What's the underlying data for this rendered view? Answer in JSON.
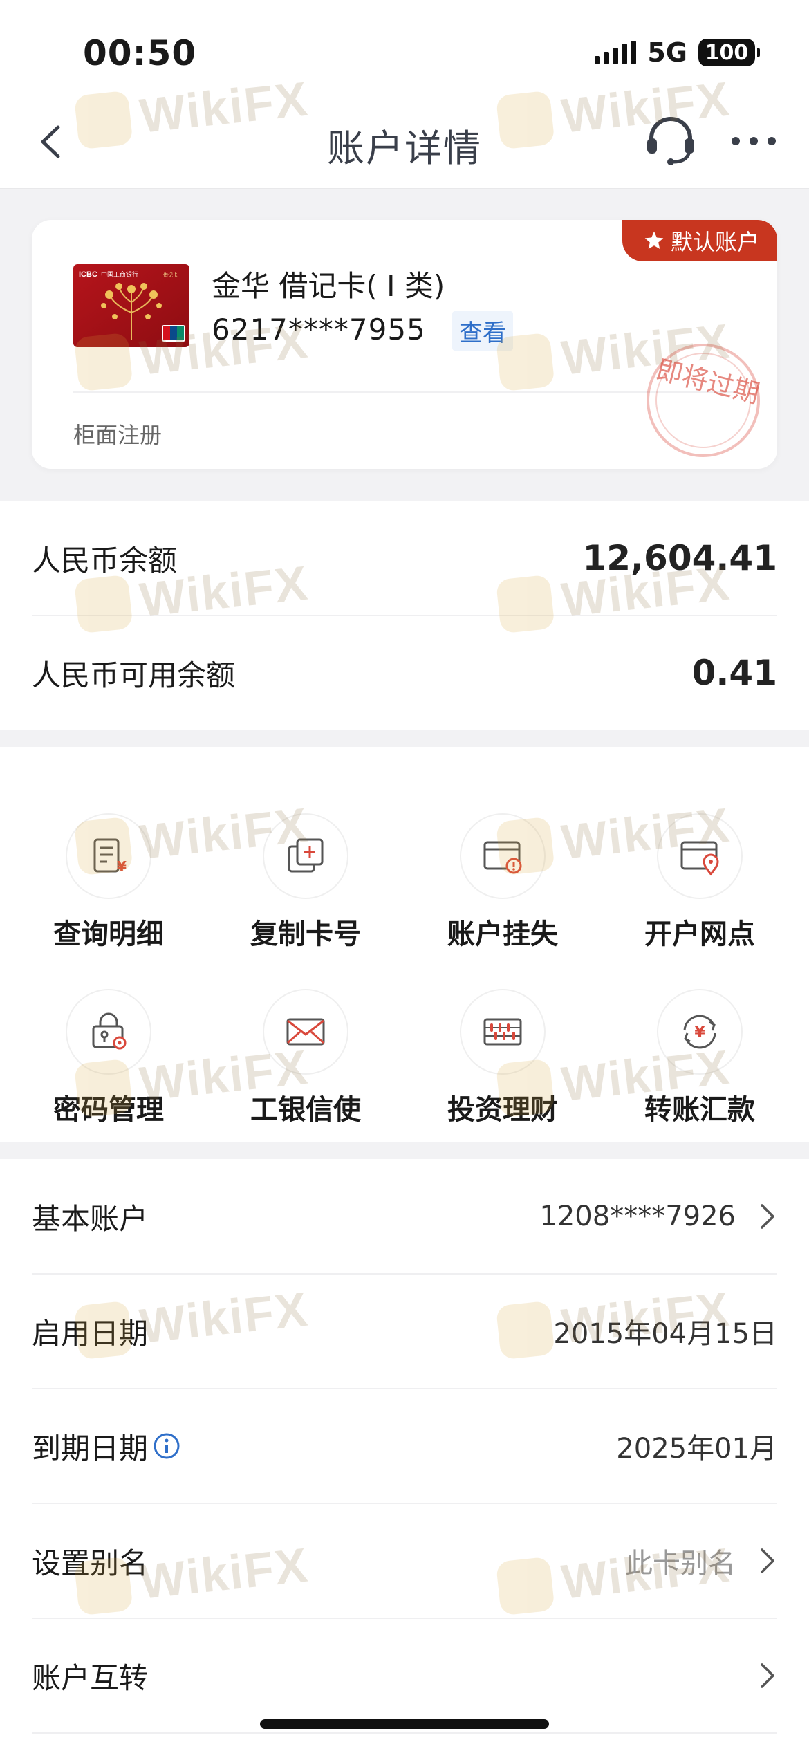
{
  "status_bar": {
    "time": "00:50",
    "network": "5G",
    "battery": "100"
  },
  "nav": {
    "title": "账户详情"
  },
  "card": {
    "default_badge": "默认账户",
    "name": "金华 借记卡( Ⅰ 类)",
    "number": "6217****7955",
    "view_label": "查看",
    "registration": "柜面注册",
    "stamp_text": "即将过期",
    "card_face": {
      "bank_short": "ICBC",
      "bank_name": "中国工商银行",
      "card_type": "借记卡",
      "network": "UnionPay"
    }
  },
  "balances": [
    {
      "label": "人民币余额",
      "value": "12,604.41"
    },
    {
      "label": "人民币可用余额",
      "value": "0.41"
    }
  ],
  "actions": [
    {
      "label": "查询明细",
      "icon": "statement-icon"
    },
    {
      "label": "复制卡号",
      "icon": "copy-card-icon"
    },
    {
      "label": "账户挂失",
      "icon": "report-loss-icon"
    },
    {
      "label": "开户网点",
      "icon": "branch-location-icon"
    },
    {
      "label": "密码管理",
      "icon": "password-lock-icon"
    },
    {
      "label": "工银信使",
      "icon": "envelope-icon"
    },
    {
      "label": "投资理财",
      "icon": "abacus-icon"
    },
    {
      "label": "转账汇款",
      "icon": "transfer-icon"
    }
  ],
  "details": [
    {
      "label": "基本账户",
      "value": "1208****7926",
      "chevron": true
    },
    {
      "label": "启用日期",
      "value": "2015年04月15日",
      "chevron": false
    },
    {
      "label": "到期日期",
      "value": "2025年01月",
      "chevron": false,
      "info": true
    },
    {
      "label": "设置别名",
      "value": "此卡别名",
      "chevron": true
    },
    {
      "label": "账户互转",
      "value": "",
      "chevron": true
    }
  ],
  "watermark": "WikiFX",
  "colors": {
    "accent_red": "#c8361f",
    "link_blue": "#2f6fc9",
    "icon_red": "#d9483b"
  }
}
